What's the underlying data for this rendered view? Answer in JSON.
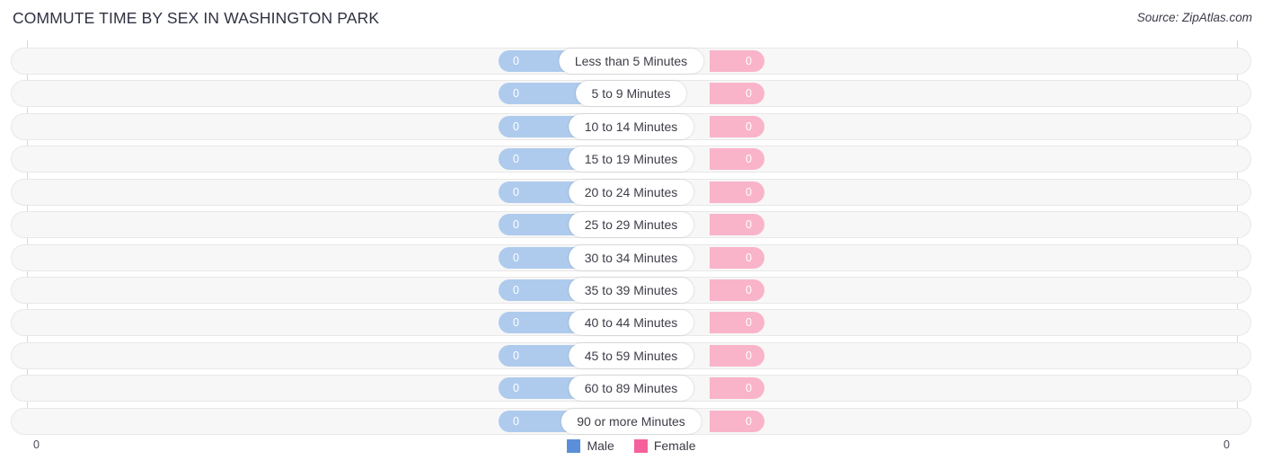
{
  "header": {
    "title": "COMMUTE TIME BY SEX IN WASHINGTON PARK",
    "source": "Source: ZipAtlas.com"
  },
  "axis": {
    "left_tick": "0",
    "right_tick": "0"
  },
  "legend": {
    "items": [
      {
        "label": "Male",
        "color": "#5b8fd9",
        "icon": "square-swatch-icon"
      },
      {
        "label": "Female",
        "color": "#f4619b",
        "icon": "square-swatch-icon"
      }
    ]
  },
  "colors": {
    "male_bar": "#aecbed",
    "female_bar": "#f9b4ca",
    "male_legend": "#5b8fd9",
    "female_legend": "#f4619b",
    "track": "#f7f7f7",
    "track_border": "#e8e8e8",
    "title": "#2f3142"
  },
  "chart_data": {
    "type": "bar",
    "title": "COMMUTE TIME BY SEX IN WASHINGTON PARK",
    "subtitle": "",
    "xlabel": "",
    "ylabel": "",
    "orientation": "horizontal",
    "layout": "diverging-bidirectional",
    "grid": false,
    "legend_position": "bottom-center",
    "xlim": [
      0,
      0
    ],
    "axis_ticks": [
      "0",
      "0"
    ],
    "categories": [
      "Less than 5 Minutes",
      "5 to 9 Minutes",
      "10 to 14 Minutes",
      "15 to 19 Minutes",
      "20 to 24 Minutes",
      "25 to 29 Minutes",
      "30 to 34 Minutes",
      "35 to 39 Minutes",
      "40 to 44 Minutes",
      "45 to 59 Minutes",
      "60 to 89 Minutes",
      "90 or more Minutes"
    ],
    "series": [
      {
        "name": "Male",
        "color": "#aecbed",
        "values": [
          0,
          0,
          0,
          0,
          0,
          0,
          0,
          0,
          0,
          0,
          0,
          0
        ],
        "value_labels": [
          "0",
          "0",
          "0",
          "0",
          "0",
          "0",
          "0",
          "0",
          "0",
          "0",
          "0",
          "0"
        ]
      },
      {
        "name": "Female",
        "color": "#f9b4ca",
        "values": [
          0,
          0,
          0,
          0,
          0,
          0,
          0,
          0,
          0,
          0,
          0,
          0
        ],
        "value_labels": [
          "0",
          "0",
          "0",
          "0",
          "0",
          "0",
          "0",
          "0",
          "0",
          "0",
          "0",
          "0"
        ]
      }
    ]
  },
  "rows": [
    {
      "label": "Less than 5 Minutes",
      "male": "0",
      "female": "0"
    },
    {
      "label": "5 to 9 Minutes",
      "male": "0",
      "female": "0"
    },
    {
      "label": "10 to 14 Minutes",
      "male": "0",
      "female": "0"
    },
    {
      "label": "15 to 19 Minutes",
      "male": "0",
      "female": "0"
    },
    {
      "label": "20 to 24 Minutes",
      "male": "0",
      "female": "0"
    },
    {
      "label": "25 to 29 Minutes",
      "male": "0",
      "female": "0"
    },
    {
      "label": "30 to 34 Minutes",
      "male": "0",
      "female": "0"
    },
    {
      "label": "35 to 39 Minutes",
      "male": "0",
      "female": "0"
    },
    {
      "label": "40 to 44 Minutes",
      "male": "0",
      "female": "0"
    },
    {
      "label": "45 to 59 Minutes",
      "male": "0",
      "female": "0"
    },
    {
      "label": "60 to 89 Minutes",
      "male": "0",
      "female": "0"
    },
    {
      "label": "90 or more Minutes",
      "male": "0",
      "female": "0"
    }
  ]
}
